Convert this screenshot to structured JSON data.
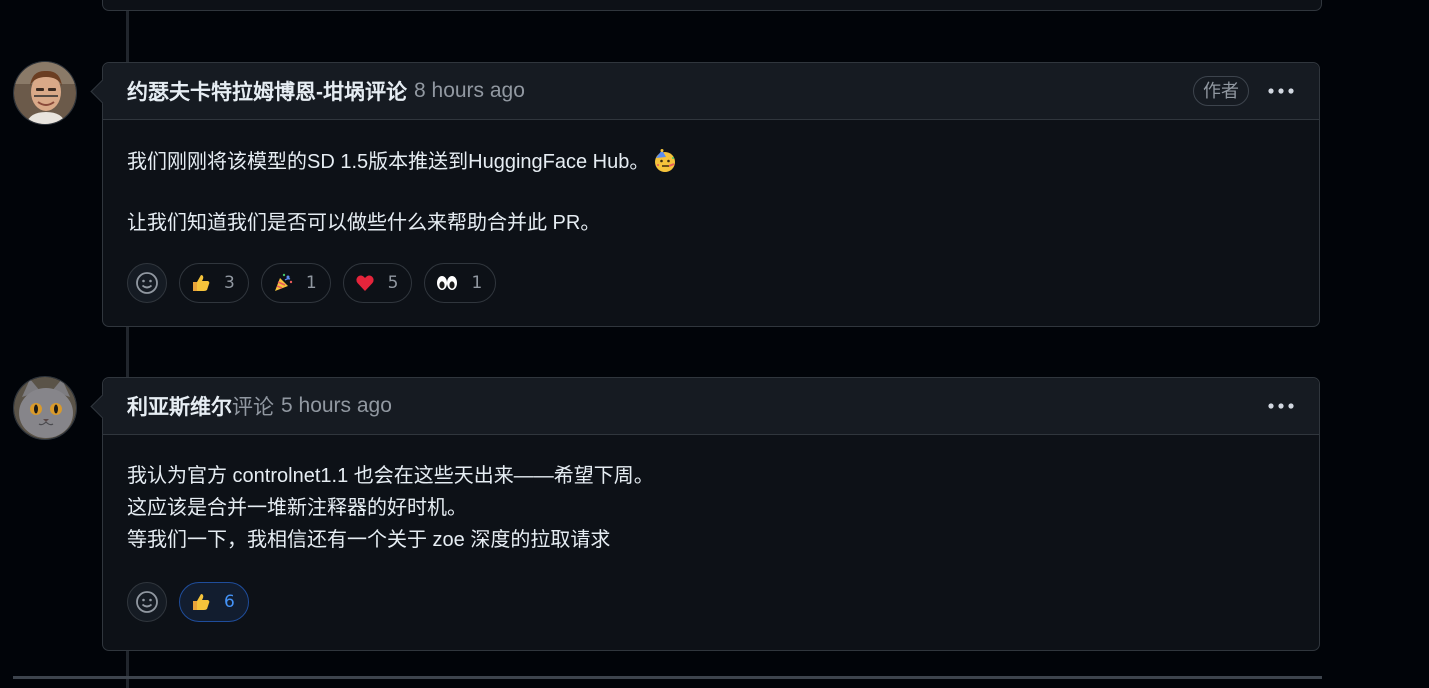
{
  "comments": [
    {
      "author": "约瑟夫卡特拉姆博恩-坩埚评论",
      "action": "",
      "time": "8 hours ago",
      "badge": "作者",
      "avatar_icon": "user-avatar-man",
      "paragraphs": [
        "我们刚刚将该模型的SD 1.5版本推送到HuggingFace Hub。",
        "让我们知道我们是否可以做些什么来帮助合并此 PR。"
      ],
      "inline_emoji": "partying-face-icon",
      "reactions": [
        {
          "icon": "thumbs-up-icon",
          "count": "3"
        },
        {
          "icon": "party-popper-icon",
          "count": "1"
        },
        {
          "icon": "heart-icon",
          "count": "5"
        },
        {
          "icon": "eyes-icon",
          "count": "1"
        }
      ]
    },
    {
      "author": "利亚斯维尔",
      "action": "评论",
      "time": "5 hours ago",
      "avatar_icon": "user-avatar-cat",
      "lines": [
        "我认为官方 controlnet1.1 也会在这些天出来——希望下周。",
        "这应该是合并一堆新注释器的好时机。",
        "等我们一下，我相信还有一个关于 zoe 深度的拉取请求"
      ],
      "reactions": [
        {
          "icon": "thumbs-up-icon",
          "count": "6",
          "active": true
        }
      ]
    }
  ],
  "colors": {
    "background": "#010409",
    "card": "#0d1117",
    "header": "#161b22",
    "border": "#30363d",
    "muted_text": "#9198a1",
    "accent_blue": "#4493f8"
  }
}
